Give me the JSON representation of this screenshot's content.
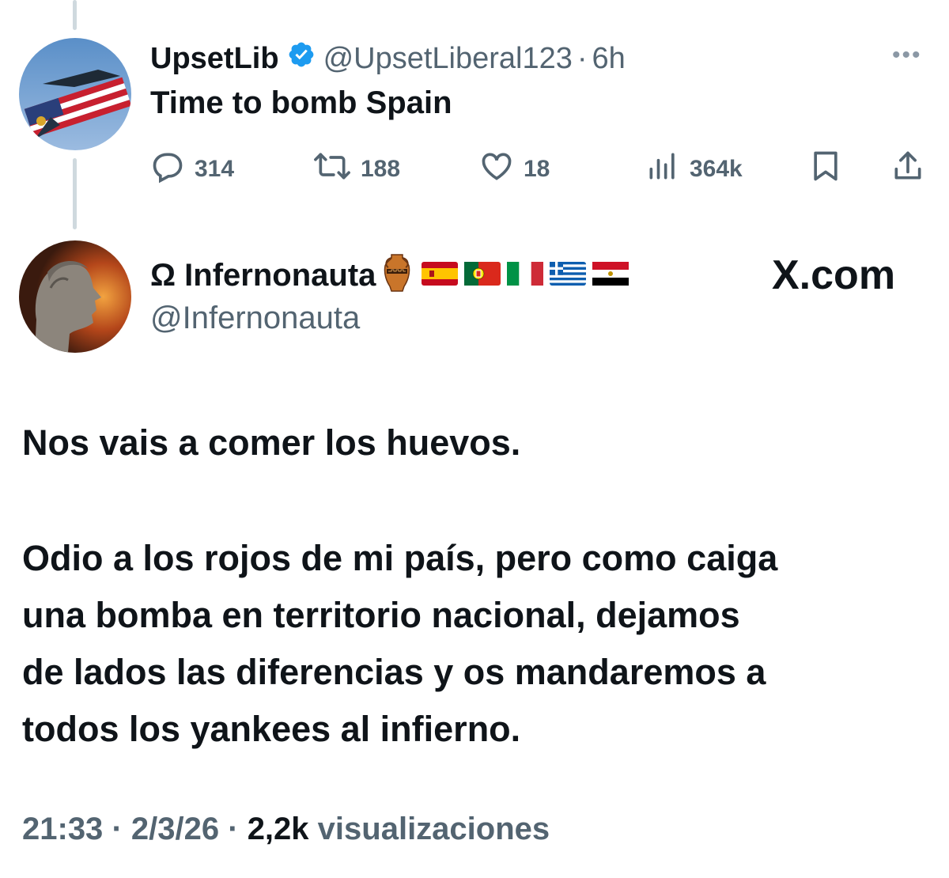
{
  "reply_tweet": {
    "display_name": "UpsetLib",
    "verified": true,
    "handle": "@UpsetLiberal123",
    "separator": "·",
    "time": "6h",
    "more_icon": "more-horizontal-icon",
    "text": "Time to bomb Spain",
    "actions": {
      "replies": "314",
      "reposts": "188",
      "likes": "18",
      "views": "364k"
    }
  },
  "main_tweet": {
    "display_name": "Ω Infernonauta",
    "handle": "@Infernonauta",
    "name_emojis": [
      "amphora",
      "flag-spain",
      "flag-portugal",
      "flag-italy",
      "flag-greece",
      "flag-egypt"
    ],
    "paragraph_1": "Nos vais a comer los huevos.",
    "paragraph_2_lines": [
      "Odio a los rojos de mi país, pero como caiga",
      "una bomba en territorio nacional, dejamos",
      "de lados las diferencias y os mandaremos a",
      "todos los yankees al infierno."
    ],
    "footer": {
      "time": "21:33",
      "date": "2/3/26",
      "separator": "·",
      "views_count": "2,2k",
      "views_label": "visualizaciones"
    }
  },
  "watermark": "X.com",
  "colors": {
    "text_primary": "#0f1419",
    "text_secondary": "#536471",
    "verified_blue": "#1d9bf0",
    "thread_line": "#cfd9de"
  }
}
